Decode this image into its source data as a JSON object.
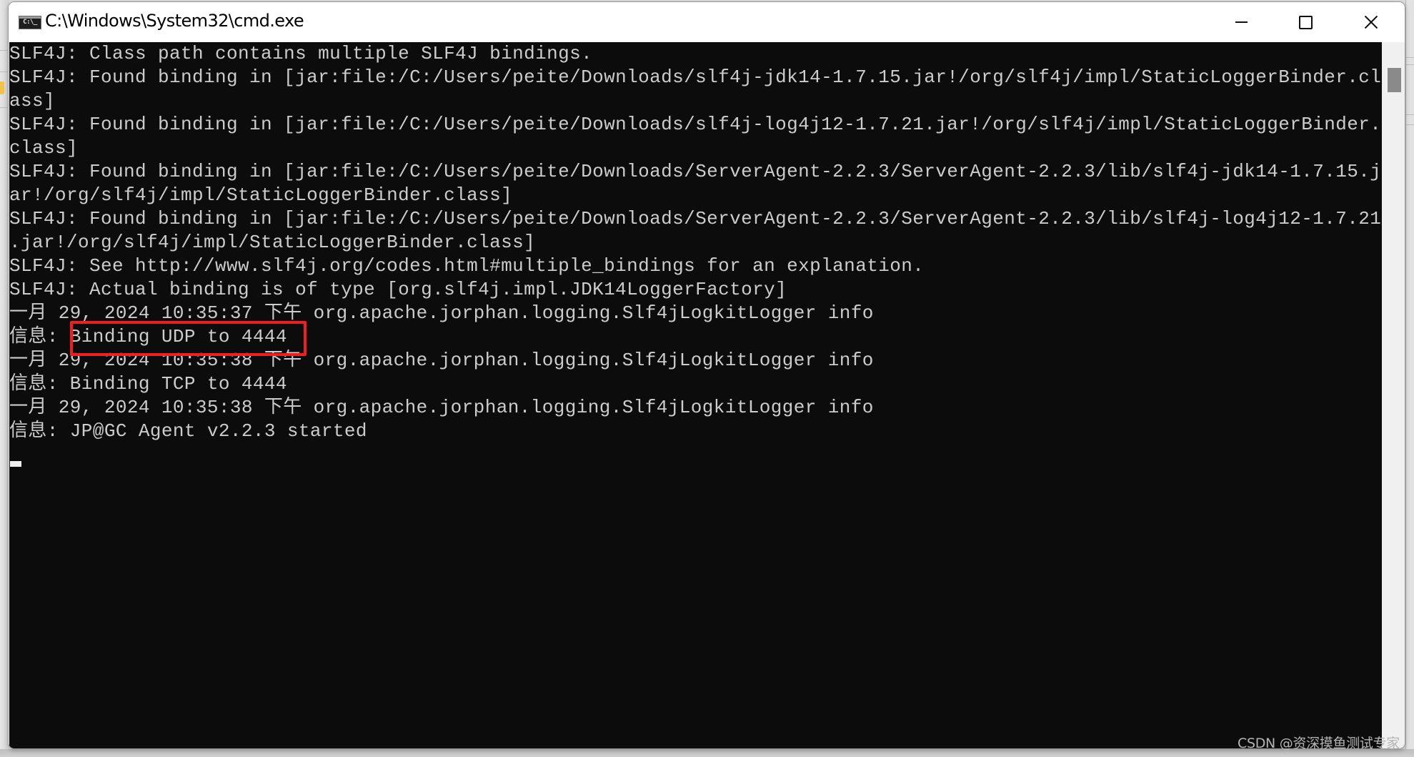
{
  "window": {
    "title": "C:\\Windows\\System32\\cmd.exe",
    "icon": "cmd-icon",
    "icon_text": "C:\\_",
    "controls": {
      "minimize": "minimize-icon",
      "maximize": "maximize-icon",
      "close": "close-icon"
    }
  },
  "console": {
    "lines": [
      "SLF4J: Class path contains multiple SLF4J bindings.",
      "SLF4J: Found binding in [jar:file:/C:/Users/peite/Downloads/slf4j-jdk14-1.7.15.jar!/org/slf4j/impl/StaticLoggerBinder.cl",
      "ass]",
      "SLF4J: Found binding in [jar:file:/C:/Users/peite/Downloads/slf4j-log4j12-1.7.21.jar!/org/slf4j/impl/StaticLoggerBinder.",
      "class]",
      "SLF4J: Found binding in [jar:file:/C:/Users/peite/Downloads/ServerAgent-2.2.3/ServerAgent-2.2.3/lib/slf4j-jdk14-1.7.15.j",
      "ar!/org/slf4j/impl/StaticLoggerBinder.class]",
      "SLF4J: Found binding in [jar:file:/C:/Users/peite/Downloads/ServerAgent-2.2.3/ServerAgent-2.2.3/lib/slf4j-log4j12-1.7.21",
      ".jar!/org/slf4j/impl/StaticLoggerBinder.class]",
      "SLF4J: See http://www.slf4j.org/codes.html#multiple_bindings for an explanation.",
      "SLF4J: Actual binding is of type [org.slf4j.impl.JDK14LoggerFactory]",
      "一月 29, 2024 10:35:37 下午 org.apache.jorphan.logging.Slf4jLogkitLogger info",
      "信息: Binding UDP to 4444",
      "一月 29, 2024 10:35:38 下午 org.apache.jorphan.logging.Slf4jLogkitLogger info",
      "信息: Binding TCP to 4444",
      "一月 29, 2024 10:35:38 下午 org.apache.jorphan.logging.Slf4jLogkitLogger info",
      "信息: JP@GC Agent v2.2.3 started"
    ],
    "highlighted_text": "Binding UDP to 4444",
    "highlight_color": "#f01e1e",
    "background_color": "#0c0c0c",
    "text_color": "#cccccc"
  },
  "watermark": "CSDN @资深摸鱼测试专家"
}
